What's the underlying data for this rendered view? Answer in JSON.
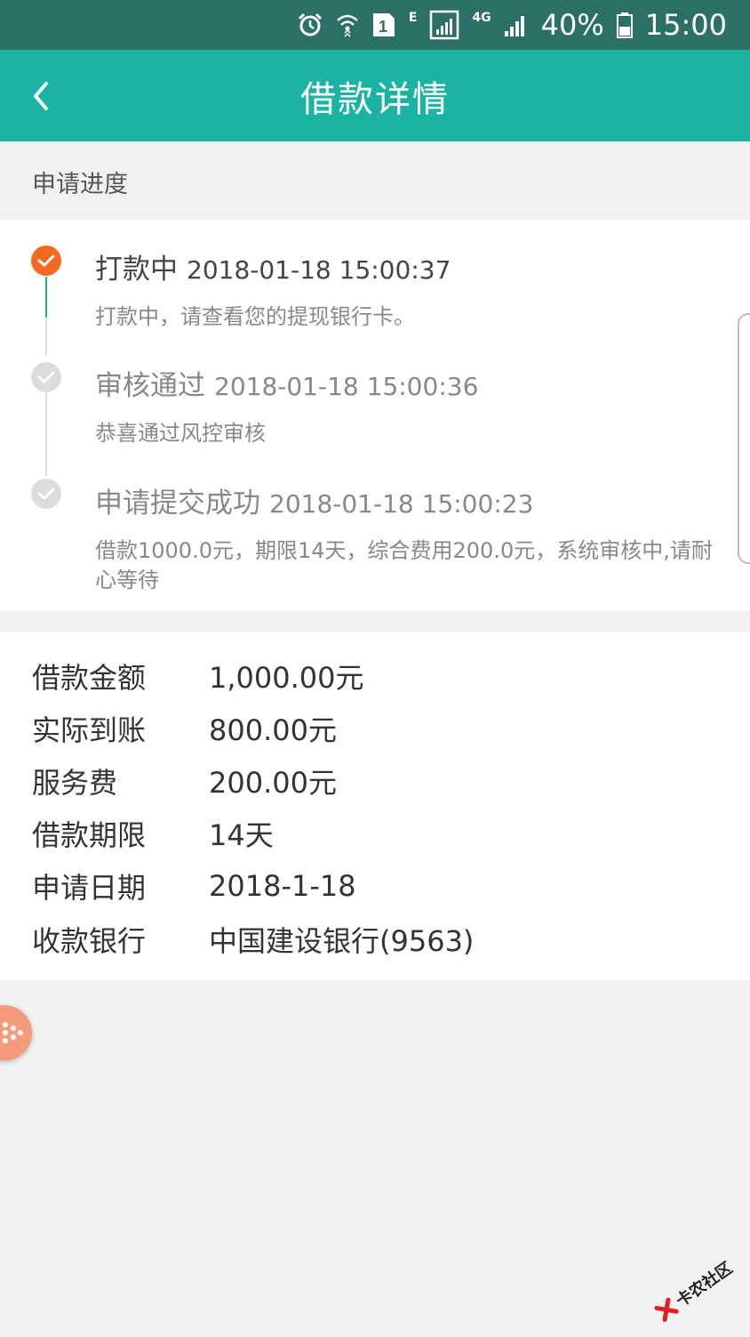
{
  "status_bar": {
    "network_e": "E",
    "network_4g": "4G",
    "battery_percent": "40%",
    "time": "15:00",
    "sim_number": "1"
  },
  "nav": {
    "title": "借款详情",
    "back_icon": "chevron-left-icon"
  },
  "progress": {
    "section_title": "申请进度",
    "steps": [
      {
        "title": "打款中",
        "time": "2018-01-18 15:00:37",
        "desc": "打款中，请查看您的提现银行卡。",
        "state": "active"
      },
      {
        "title": "审核通过",
        "time": "2018-01-18 15:00:36",
        "desc": "恭喜通过风控审核",
        "state": "done"
      },
      {
        "title": "申请提交成功",
        "time": "2018-01-18 15:00:23",
        "desc": "借款1000.0元，期限14天，综合费用200.0元，系统审核中,请耐心等待",
        "state": "done"
      }
    ]
  },
  "details": [
    {
      "label": "借款金额",
      "value": "1,000.00元"
    },
    {
      "label": "实际到账",
      "value": "800.00元"
    },
    {
      "label": "服务费",
      "value": "200.00元"
    },
    {
      "label": "借款期限",
      "value": "14天"
    },
    {
      "label": "申请日期",
      "value": "2018-1-18"
    },
    {
      "label": "收款银行",
      "value": "中国建设银行(9563)"
    }
  ],
  "watermark": {
    "text": "卡农社区"
  },
  "colors": {
    "status_bar": "#2b6f66",
    "nav_bar": "#1bb3a3",
    "active_step": "#f26a21",
    "done_step": "#dcdcdc",
    "float_button": "#f59a7a"
  }
}
